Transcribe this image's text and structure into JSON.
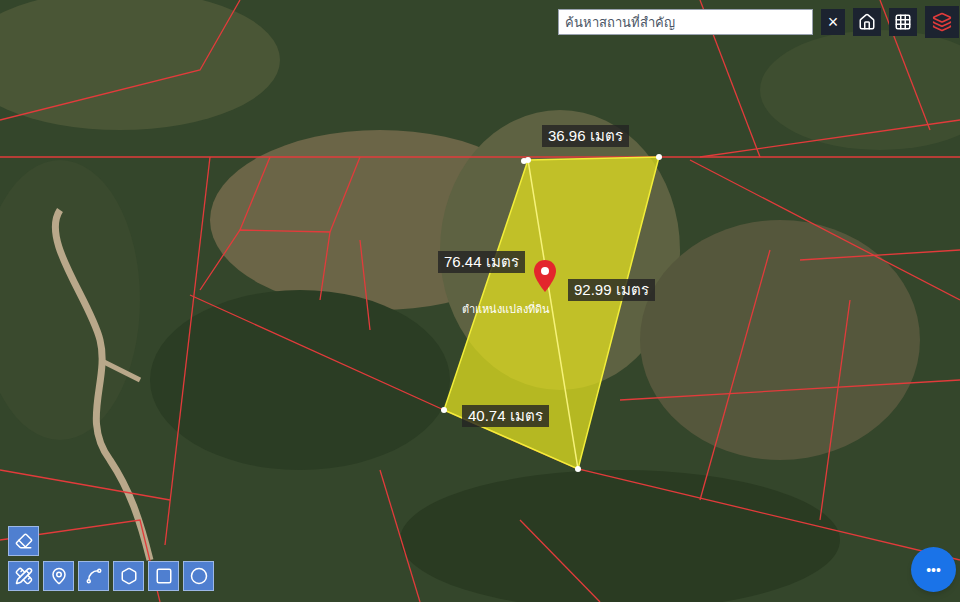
{
  "search": {
    "placeholder": "ค้นหาสถานที่สำคัญ",
    "clear": "×"
  },
  "measurements": [
    "36.96 เมตร",
    "76.44 เมตร",
    "92.99 เมตร",
    "40.74 เมตร"
  ],
  "pin": {
    "label": "ตำแหน่งแปลงที่ดิน"
  },
  "more_button": "•••"
}
